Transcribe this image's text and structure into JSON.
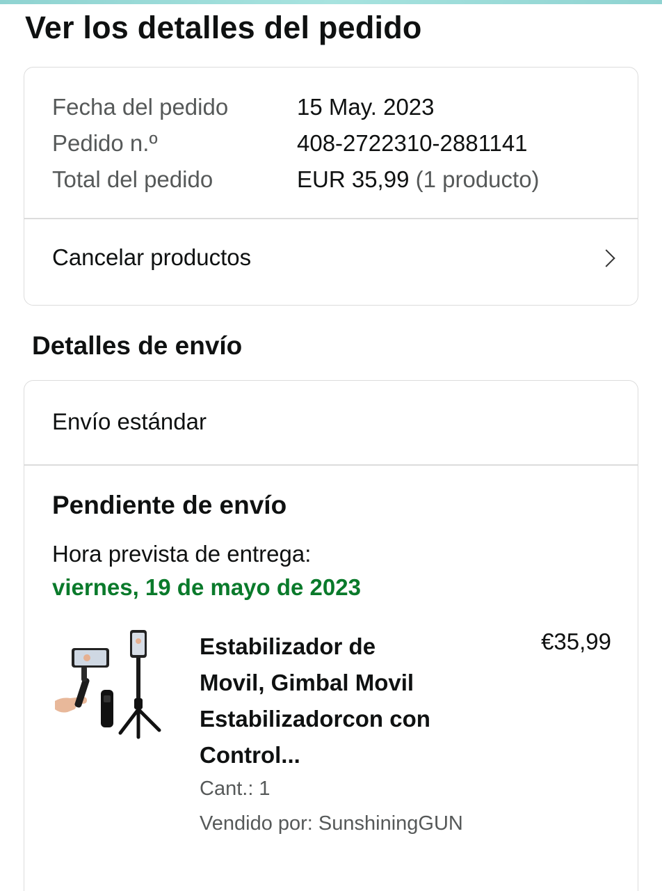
{
  "page": {
    "title": "Ver los detalles del pedido"
  },
  "order": {
    "date_label": "Fecha del pedido",
    "date_value": "15 May.  2023",
    "number_label": "Pedido n.º",
    "number_value": "408-2722310-2881141",
    "total_label": "Total del pedido",
    "total_value": "EUR 35,99",
    "total_count": "(1 producto)",
    "cancel_label": "Cancelar productos"
  },
  "shipping": {
    "section_title": "Detalles de envío",
    "method": "Envío estándar",
    "status": "Pendiente de envío",
    "eta_label": "Hora prevista de entrega:",
    "eta_date": "viernes, 19 de mayo de 2023",
    "eta_color": "#0a7a2b"
  },
  "product": {
    "title_lines": [
      "Estabilizador de",
      "Movil, Gimbal Movil",
      "Estabilizadorcon con",
      "Control..."
    ],
    "price": "€35,99",
    "qty": "Cant.: 1",
    "seller": "Vendido por: SunshiningGUN",
    "image_icon": "gimbal-stabilizer-tripod-image"
  },
  "icons": {
    "chevron": "chevron-right-icon"
  }
}
